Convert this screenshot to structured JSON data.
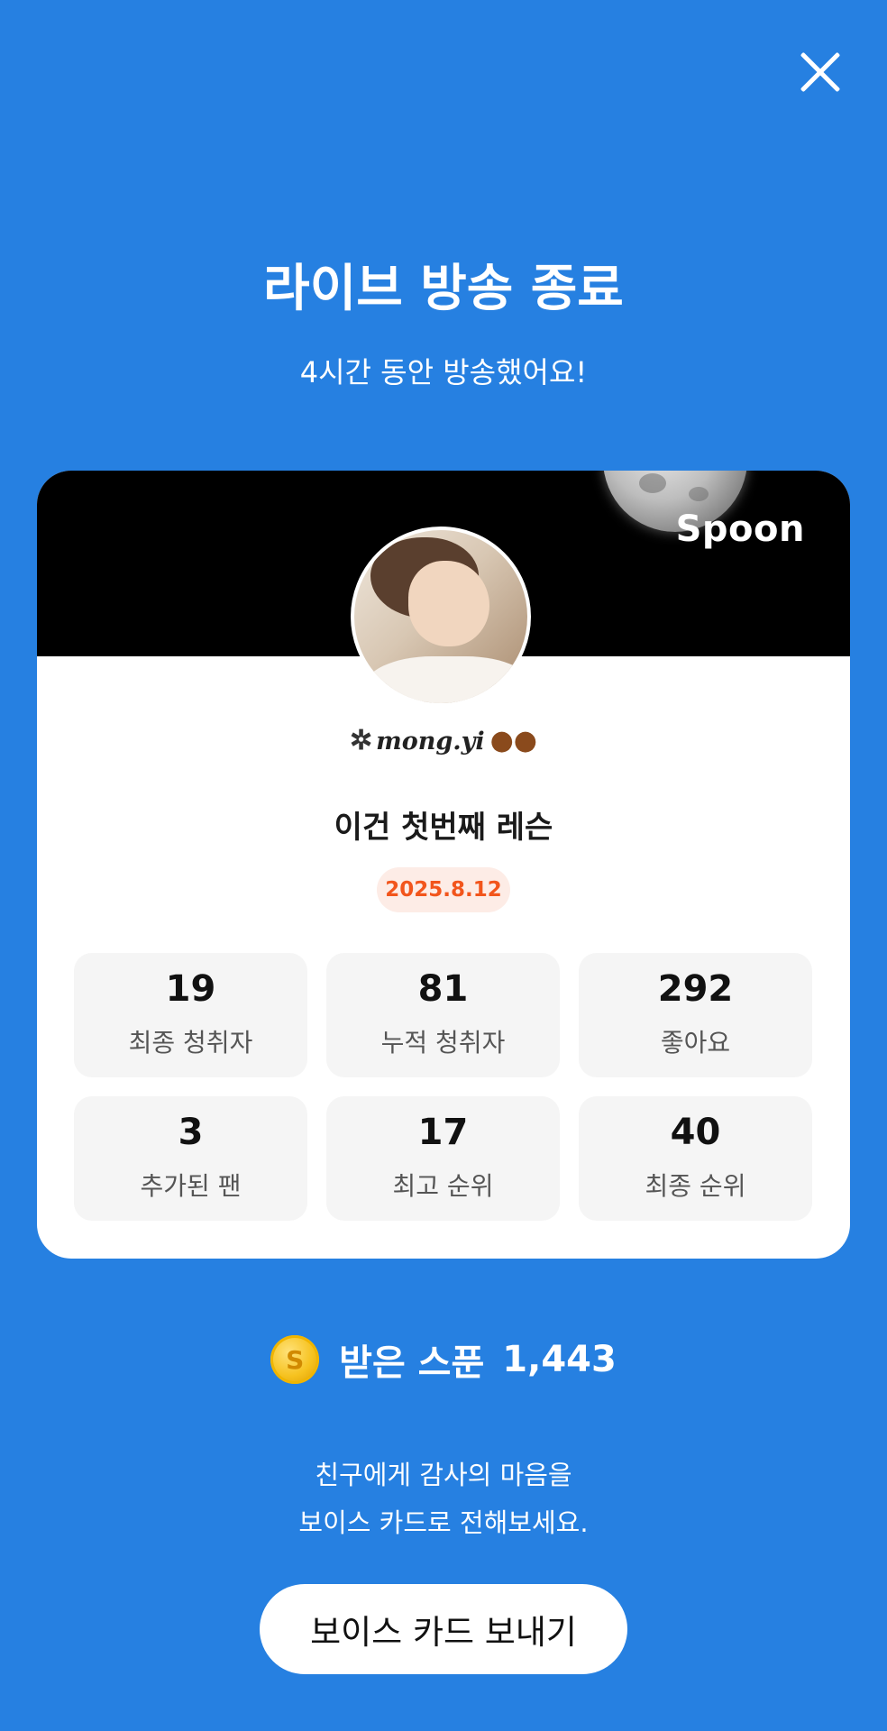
{
  "header": {
    "close_icon": "close-icon"
  },
  "title": "라이브 방송 종료",
  "subtitle": "4시간 동안 방송했어요!",
  "card": {
    "brand_logo": "Spoon",
    "nickname": "mong.yi",
    "nickname_prefix_icon": "pinwheel-icon",
    "nickname_suffix_icon": "paw-icon",
    "broadcast_title": "이건 첫번째 레슨",
    "date": "2025.8.12",
    "stats": [
      {
        "value": "19",
        "label": "최종 청취자"
      },
      {
        "value": "81",
        "label": "누적 청취자"
      },
      {
        "value": "292",
        "label": "좋아요"
      },
      {
        "value": "3",
        "label": "추가된 팬"
      },
      {
        "value": "17",
        "label": "최고 순위"
      },
      {
        "value": "40",
        "label": "최종 순위"
      }
    ]
  },
  "spoons": {
    "icon": "coin-icon",
    "coin_letter": "S",
    "label": "받은 스푼",
    "count": "1,443"
  },
  "thanks": {
    "line1": "친구에게 감사의 마음을",
    "line2": "보이스 카드로 전해보세요."
  },
  "cta": {
    "label": "보이스 카드 보내기"
  },
  "colors": {
    "background": "#2680E1",
    "date_badge_text": "#F2551C",
    "date_badge_bg": "#FDECE6"
  }
}
